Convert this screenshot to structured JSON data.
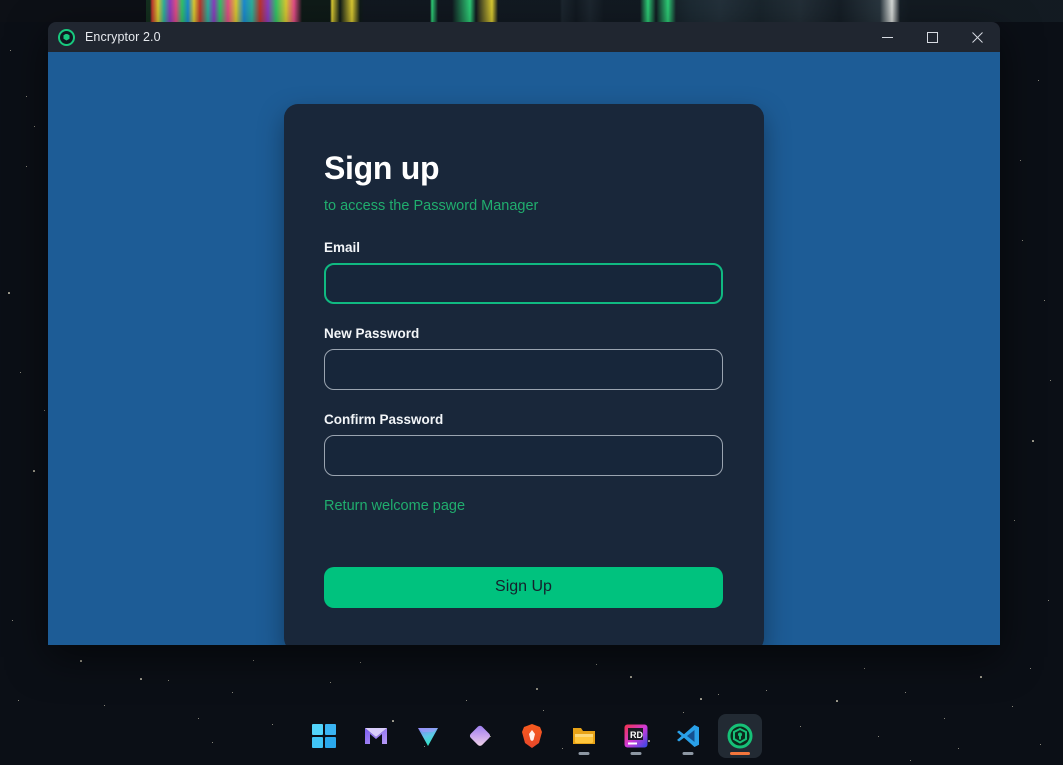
{
  "window": {
    "title": "Encryptor 2.0",
    "icon": "encryptor-shield-icon",
    "controls": {
      "minimize": "minimize-icon",
      "maximize": "maximize-icon",
      "close": "close-icon"
    }
  },
  "colors": {
    "window_background": "#1d5c96",
    "card_background": "#19273a",
    "accent_green": "#00c27e",
    "link_green": "#20ad6e",
    "titlebar": "#202630",
    "focus_border": "#10b981",
    "desktop": "#0b0f16"
  },
  "card": {
    "heading": "Sign up",
    "subheading": "to access the Password Manager",
    "fields": [
      {
        "label": "Email",
        "value": "",
        "placeholder": "",
        "type": "text",
        "focused": true,
        "name": "email-field"
      },
      {
        "label": "New Password",
        "value": "",
        "placeholder": "",
        "type": "password",
        "focused": false,
        "name": "new-password-field"
      },
      {
        "label": "Confirm Password",
        "value": "",
        "placeholder": "",
        "type": "password",
        "focused": false,
        "name": "confirm-password-field"
      }
    ],
    "return_link": "Return welcome page",
    "submit_label": "Sign Up"
  },
  "taskbar": {
    "items": [
      {
        "name": "windows-start-icon",
        "label": "Start",
        "active": false,
        "running": false
      },
      {
        "name": "mail-icon",
        "label": "Mail",
        "active": false,
        "running": false
      },
      {
        "name": "triangle-app-icon",
        "label": "Triangle App",
        "active": false,
        "running": false
      },
      {
        "name": "diamond-app-icon",
        "label": "Diamond App",
        "active": false,
        "running": false
      },
      {
        "name": "brave-browser-icon",
        "label": "Brave",
        "active": false,
        "running": false
      },
      {
        "name": "file-explorer-icon",
        "label": "File Explorer",
        "active": false,
        "running": true
      },
      {
        "name": "rider-icon",
        "label": "RD",
        "active": false,
        "running": true
      },
      {
        "name": "vscode-icon",
        "label": "Visual Studio Code",
        "active": false,
        "running": true
      },
      {
        "name": "encryptor-icon",
        "label": "Encryptor 2.0",
        "active": true,
        "running": true
      }
    ]
  }
}
